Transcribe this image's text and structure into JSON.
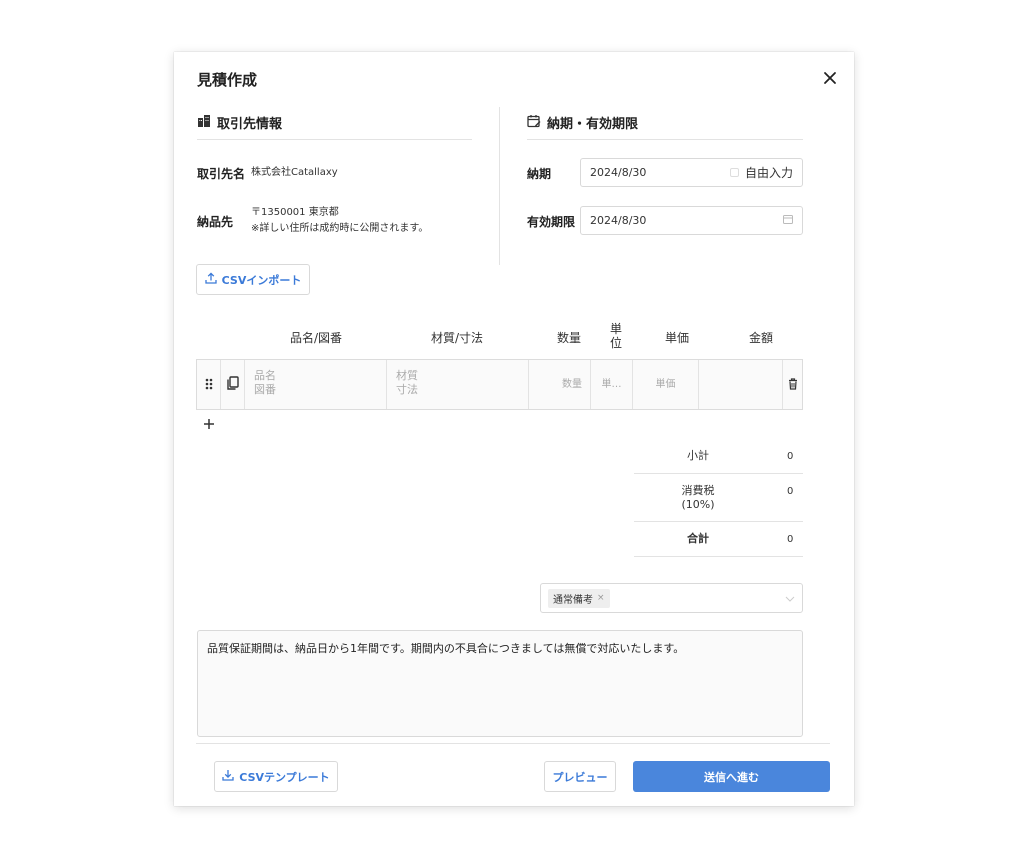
{
  "modal": {
    "title": "見積作成"
  },
  "client_section": {
    "heading": "取引先情報",
    "client_name_label": "取引先名",
    "client_name_value": "株式会社Catallaxy",
    "delivery_label": "納品先",
    "delivery_address": "〒1350001 東京都",
    "delivery_note": "※詳しい住所は成約時に公開されます。"
  },
  "deadline_section": {
    "heading": "納期・有効期限",
    "delivery_date_label": "納期",
    "delivery_date_value": "2024/8/30",
    "free_input_label": "自由入力",
    "expiry_label": "有効期限",
    "expiry_value": "2024/8/30"
  },
  "csv_import_label": "CSVインポート",
  "table": {
    "headers": {
      "name": "品名/図番",
      "material": "材質/寸法",
      "quantity": "数量",
      "unit_line1": "単",
      "unit_line2": "位",
      "unit_price": "単価",
      "amount": "金額"
    },
    "row_placeholders": {
      "name_line1": "品名",
      "name_line2": "図番",
      "material_line1": "材質",
      "material_line2": "寸法",
      "quantity": "数量",
      "unit": "単…",
      "unit_price": "単価"
    }
  },
  "summary": {
    "subtotal_label": "小計",
    "subtotal_value": "0",
    "tax_label_line1": "消費税",
    "tax_label_line2": "(10%)",
    "tax_value": "0",
    "total_label": "合計",
    "total_value": "0"
  },
  "remarks": {
    "selected_tag": "通常備考",
    "text": "品質保証期間は、納品日から1年間です。期間内の不具合につきましては無償で対応いたします。"
  },
  "footer": {
    "csv_template_label": "CSVテンプレート",
    "preview_label": "プレビュー",
    "submit_label": "送信へ進む"
  },
  "colors": {
    "accent": "#4a86dc",
    "link": "#3b7ad8"
  }
}
